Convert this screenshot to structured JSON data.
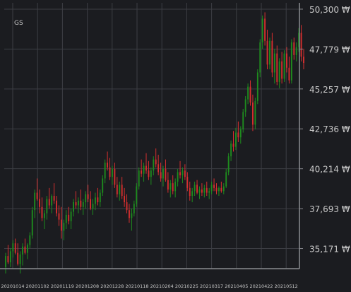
{
  "chart_data": {
    "type": "candlestick",
    "title": "GS",
    "y_ticks": [
      {
        "value": 35171,
        "label": "35,171 ₩"
      },
      {
        "value": 37693,
        "label": "37,693 ₩"
      },
      {
        "value": 40214,
        "label": "40,214 ₩"
      },
      {
        "value": 42736,
        "label": "42,736 ₩"
      },
      {
        "value": 45257,
        "label": "45,257 ₩"
      },
      {
        "value": 47779,
        "label": "47,779 ₩"
      },
      {
        "value": 50300,
        "label": "50,300 ₩"
      }
    ],
    "ylim": [
      33900,
      50700
    ],
    "x_tick_labels": [
      "20201014",
      "20201102",
      "20201119",
      "20201208",
      "20201228",
      "20210118",
      "20210204",
      "20210225",
      "20210317",
      "20210405",
      "20210422",
      "20210512"
    ],
    "grid": true,
    "colors": {
      "background": "#1b1c20",
      "grid": "#3d3e44",
      "axis": "#8a8b90",
      "up": "#1e8b1e",
      "down": "#d62f2f",
      "text": "#c8c8c8"
    },
    "ohlc": [
      [
        34000,
        34900,
        33600,
        34700
      ],
      [
        34700,
        35400,
        34200,
        34300
      ],
      [
        34300,
        35200,
        34000,
        35000
      ],
      [
        35000,
        35700,
        34600,
        35500
      ],
      [
        35500,
        35800,
        34800,
        34900
      ],
      [
        34900,
        35500,
        34100,
        34200
      ],
      [
        34200,
        35000,
        33600,
        34800
      ],
      [
        34800,
        35500,
        34100,
        35300
      ],
      [
        35300,
        35800,
        34800,
        34900
      ],
      [
        34900,
        35500,
        34500,
        35400
      ],
      [
        35400,
        36200,
        35200,
        36000
      ],
      [
        36000,
        37800,
        35800,
        37600
      ],
      [
        37600,
        38900,
        37100,
        38700
      ],
      [
        38700,
        39600,
        38200,
        38300
      ],
      [
        38300,
        38900,
        37400,
        37800
      ],
      [
        37800,
        38400,
        36900,
        37100
      ],
      [
        37100,
        37600,
        36400,
        37400
      ],
      [
        37400,
        38500,
        37000,
        38300
      ],
      [
        38300,
        39000,
        37700,
        37900
      ],
      [
        37900,
        38600,
        37400,
        38500
      ],
      [
        38500,
        39300,
        38000,
        38200
      ],
      [
        38200,
        38500,
        37200,
        37400
      ],
      [
        37400,
        37900,
        36600,
        37000
      ],
      [
        37000,
        37800,
        35800,
        36300
      ],
      [
        36300,
        37000,
        35700,
        36800
      ],
      [
        36800,
        37600,
        36400,
        37300
      ],
      [
        37300,
        37800,
        36700,
        36900
      ],
      [
        36900,
        37700,
        36400,
        37500
      ],
      [
        37500,
        38300,
        37200,
        38100
      ],
      [
        38100,
        38800,
        37700,
        37900
      ],
      [
        37900,
        38400,
        37400,
        38200
      ],
      [
        38200,
        38900,
        37600,
        37800
      ],
      [
        37800,
        38300,
        37300,
        38100
      ],
      [
        38100,
        38800,
        37700,
        38600
      ],
      [
        38600,
        39200,
        38100,
        38300
      ],
      [
        38300,
        38800,
        37600,
        37700
      ],
      [
        37700,
        38300,
        37300,
        38000
      ],
      [
        38000,
        38700,
        37600,
        38400
      ],
      [
        38400,
        39000,
        37900,
        38100
      ],
      [
        38100,
        38900,
        37800,
        38700
      ],
      [
        38700,
        39800,
        38500,
        39600
      ],
      [
        39600,
        40800,
        39300,
        40600
      ],
      [
        40600,
        41300,
        40100,
        40300
      ],
      [
        40300,
        40900,
        39500,
        39700
      ],
      [
        39700,
        40400,
        39200,
        40200
      ],
      [
        40200,
        40600,
        39000,
        39200
      ],
      [
        39200,
        39700,
        38400,
        38600
      ],
      [
        38600,
        39400,
        38200,
        39200
      ],
      [
        39200,
        39700,
        38300,
        38500
      ],
      [
        38500,
        39000,
        37800,
        38100
      ],
      [
        38100,
        38600,
        37400,
        37600
      ],
      [
        37600,
        38000,
        36800,
        37100
      ],
      [
        37100,
        37700,
        36300,
        37400
      ],
      [
        37400,
        38200,
        37200,
        38000
      ],
      [
        38000,
        39300,
        37800,
        39100
      ],
      [
        39100,
        40300,
        38900,
        40100
      ],
      [
        40100,
        40800,
        39700,
        39900
      ],
      [
        39900,
        40600,
        39400,
        40400
      ],
      [
        40400,
        41200,
        39900,
        40100
      ],
      [
        40100,
        40700,
        39500,
        39700
      ],
      [
        39700,
        40300,
        39200,
        40100
      ],
      [
        40100,
        41000,
        39800,
        40800
      ],
      [
        40800,
        41500,
        40300,
        40500
      ],
      [
        40500,
        41100,
        39800,
        40000
      ],
      [
        40000,
        40600,
        39400,
        39600
      ],
      [
        39600,
        40400,
        39100,
        40200
      ],
      [
        40200,
        40800,
        39400,
        39500
      ],
      [
        39500,
        40000,
        38700,
        38900
      ],
      [
        38900,
        39500,
        38400,
        39300
      ],
      [
        39300,
        39800,
        38600,
        38800
      ],
      [
        38800,
        39600,
        38400,
        39400
      ],
      [
        39400,
        40200,
        39100,
        40000
      ],
      [
        40000,
        40700,
        39600,
        39800
      ],
      [
        39800,
        40300,
        39300,
        40100
      ],
      [
        40100,
        40500,
        39500,
        39700
      ],
      [
        39700,
        40000,
        38800,
        39000
      ],
      [
        39000,
        39400,
        38200,
        38500
      ],
      [
        38500,
        39000,
        38100,
        38800
      ],
      [
        38800,
        39400,
        38500,
        39200
      ],
      [
        39200,
        39500,
        38600,
        38700
      ],
      [
        38700,
        39100,
        38300,
        38900
      ],
      [
        38900,
        39300,
        38500,
        38700
      ],
      [
        38700,
        39200,
        38400,
        39000
      ],
      [
        39000,
        39400,
        38500,
        38700
      ],
      [
        38700,
        39000,
        38300,
        38800
      ],
      [
        38800,
        39400,
        38600,
        39200
      ],
      [
        39200,
        39600,
        38800,
        39000
      ],
      [
        39000,
        39300,
        38600,
        38800
      ],
      [
        38800,
        39100,
        38500,
        39000
      ],
      [
        39000,
        39400,
        38700,
        38800
      ],
      [
        38800,
        39300,
        38600,
        39100
      ],
      [
        39100,
        40200,
        39000,
        40000
      ],
      [
        40000,
        41200,
        39800,
        41000
      ],
      [
        41000,
        42000,
        40700,
        41800
      ],
      [
        41800,
        42600,
        41300,
        41600
      ],
      [
        41600,
        42800,
        41400,
        42500
      ],
      [
        42500,
        43200,
        41900,
        42200
      ],
      [
        42200,
        42900,
        41800,
        42700
      ],
      [
        42700,
        44000,
        42500,
        43800
      ],
      [
        43800,
        44800,
        43500,
        44600
      ],
      [
        44600,
        45600,
        44300,
        45400
      ],
      [
        45400,
        45800,
        44200,
        44400
      ],
      [
        44400,
        44900,
        42600,
        43000
      ],
      [
        43000,
        44700,
        42700,
        44500
      ],
      [
        44500,
        46500,
        44300,
        46300
      ],
      [
        46300,
        48400,
        46000,
        48200
      ],
      [
        48200,
        49900,
        47800,
        49700
      ],
      [
        49700,
        50100,
        48000,
        48300
      ],
      [
        48300,
        49000,
        46500,
        46800
      ],
      [
        46800,
        48500,
        46500,
        48300
      ],
      [
        48300,
        48800,
        46000,
        46300
      ],
      [
        46300,
        47800,
        45600,
        47500
      ],
      [
        47500,
        48000,
        45500,
        45700
      ],
      [
        45700,
        47200,
        45300,
        47000
      ],
      [
        47000,
        47600,
        45600,
        45900
      ],
      [
        45900,
        47700,
        45700,
        47500
      ],
      [
        47500,
        47900,
        46300,
        46600
      ],
      [
        46600,
        47300,
        45600,
        45800
      ],
      [
        45800,
        48400,
        45600,
        48200
      ],
      [
        48200,
        48500,
        47100,
        47400
      ],
      [
        47400,
        48200,
        47000,
        47900
      ],
      [
        47900,
        49100,
        47600,
        48800
      ],
      [
        48800,
        49300,
        47000,
        47300
      ],
      [
        47300,
        47800,
        46500,
        46900
      ]
    ]
  }
}
